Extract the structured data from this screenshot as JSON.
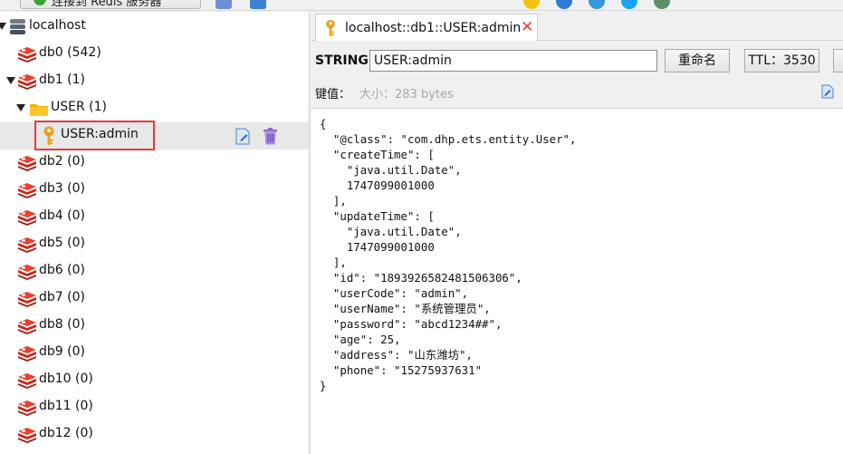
{
  "toolbar": {
    "connect_label": "连接到 Redis 服务器"
  },
  "tree": {
    "server": "localhost",
    "databases": [
      {
        "name": "db0",
        "count": "(542)"
      },
      {
        "name": "db1",
        "count": "(1)"
      },
      {
        "name": "db2",
        "count": "(0)"
      },
      {
        "name": "db3",
        "count": "(0)"
      },
      {
        "name": "db4",
        "count": "(0)"
      },
      {
        "name": "db5",
        "count": "(0)"
      },
      {
        "name": "db6",
        "count": "(0)"
      },
      {
        "name": "db7",
        "count": "(0)"
      },
      {
        "name": "db8",
        "count": "(0)"
      },
      {
        "name": "db9",
        "count": "(0)"
      },
      {
        "name": "db10",
        "count": "(0)"
      },
      {
        "name": "db11",
        "count": "(0)"
      },
      {
        "name": "db12",
        "count": "(0)"
      }
    ],
    "folder": {
      "name": "USER",
      "count": "(1)"
    },
    "selected_key": "USER:admin"
  },
  "tab": {
    "title": "localhost::db1::USER:admin",
    "close_glyph": "✕"
  },
  "key_view": {
    "type_label": "STRING:",
    "key_value": "USER:admin",
    "rename_label": "重命名",
    "ttl_label": "TTL：3530",
    "value_label": "键值：",
    "size_label": "大小：283 bytes",
    "value_text": "{\n  \"@class\": \"com.dhp.ets.entity.User\",\n  \"createTime\": [\n    \"java.util.Date\",\n    1747099001000\n  ],\n  \"updateTime\": [\n    \"java.util.Date\",\n    1747099001000\n  ],\n  \"id\": \"1893926582481506306\",\n  \"userCode\": \"admin\",\n  \"userName\": \"系统管理员\",\n  \"password\": \"abcd1234##\",\n  \"age\": 25,\n  \"address\": \"山东潍坊\",\n  \"phone\": \"15275937631\"\n}"
  },
  "colors": {
    "db_red": "#d7261e",
    "folder_yellow": "#f5b400",
    "key_orange": "#e8a21a",
    "close_red": "#e03c3c",
    "selection_border": "#e03c3c",
    "trash_purple": "#8a6ad0"
  }
}
